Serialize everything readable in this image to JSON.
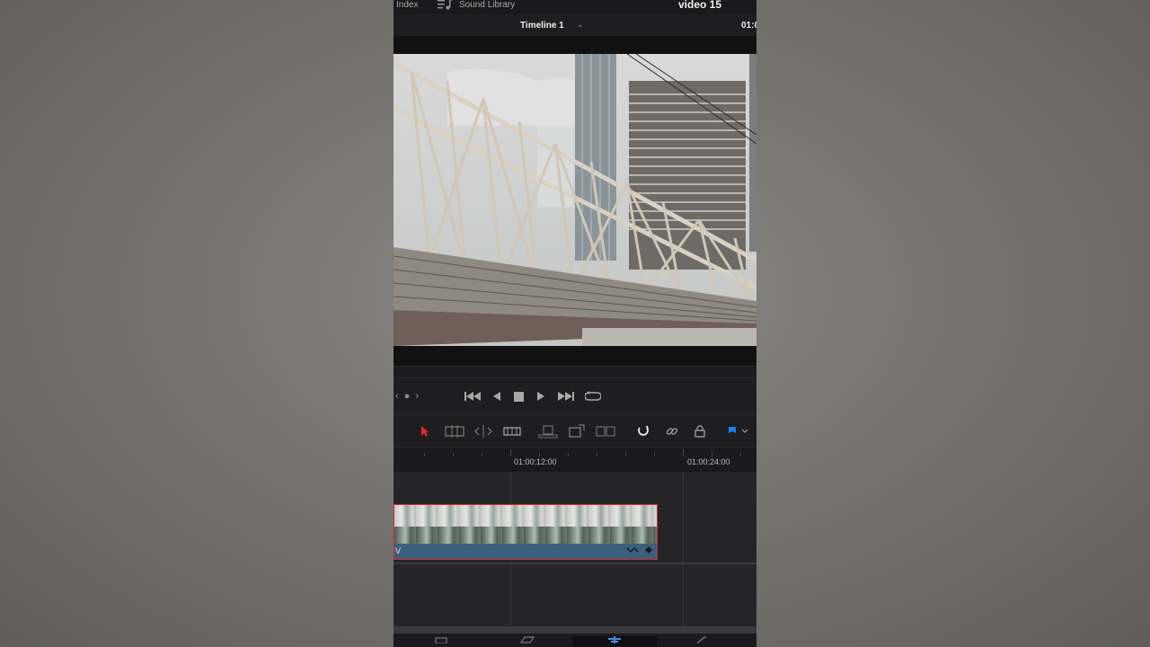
{
  "topbar": {
    "index_label": "Index",
    "sound_library_label": "Sound Library",
    "project_title": "video 15"
  },
  "timeline_bar": {
    "timeline_name": "Timeline 1",
    "timecode": "01:0"
  },
  "ruler": {
    "marks": [
      "01:00:12:00",
      "01:00:24:00"
    ]
  },
  "clip": {
    "track_label": "V"
  },
  "colors": {
    "accent_red": "#d02a35",
    "clip_blue": "#3c5f7d",
    "flag_blue": "#1e7cf2",
    "panel_bg": "#1c1c1e"
  }
}
